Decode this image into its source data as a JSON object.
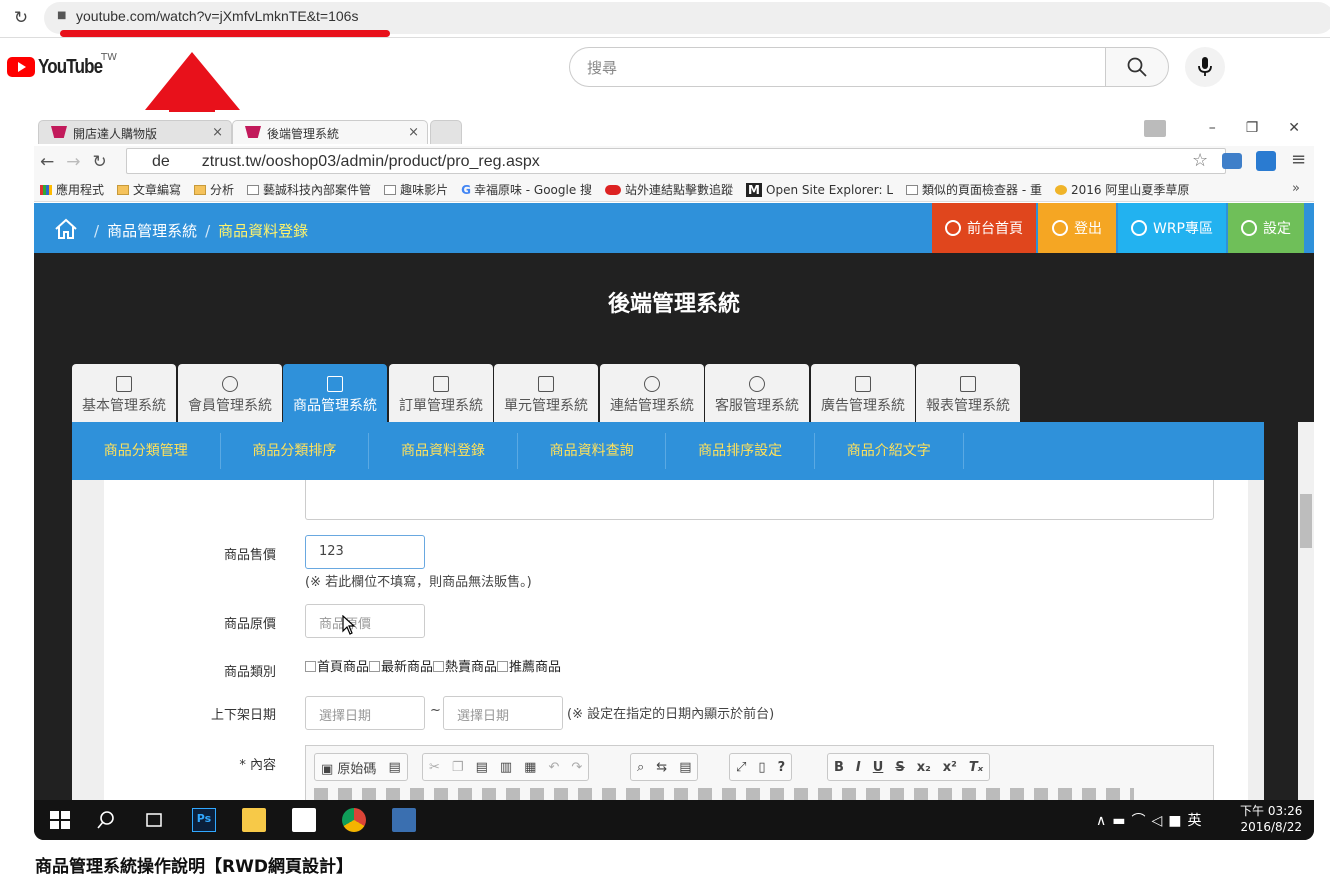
{
  "outer_browser": {
    "url": "youtube.com/watch?v=jXmfvLmknTE&t=106s"
  },
  "youtube": {
    "logo_text": "YouTube",
    "region": "TW",
    "search_placeholder": "搜尋",
    "video_title": "商品管理系統操作說明【RWD網頁設計】"
  },
  "inner_browser": {
    "tabs": [
      {
        "label": "開店達人購物版"
      },
      {
        "label": "後端管理系統"
      }
    ],
    "url_prefix": "de",
    "url_rest": "ztrust.tw/ooshop03/admin/product/pro_reg.aspx",
    "bookmarks": [
      "應用程式",
      "文章編寫",
      "分析",
      "藝誠科技內部案件管",
      "趣味影片",
      "幸福原味 - Google 搜",
      "站外連結點擊數追蹤",
      "Open Site Explorer: L",
      "類似的頁面檢查器 - 重",
      "2016 阿里山夏季草原"
    ]
  },
  "admin": {
    "breadcrumb": {
      "root": "商品管理系統",
      "current": "商品資料登錄"
    },
    "top_buttons": [
      {
        "label": "前台首頁",
        "color": "#e0461d"
      },
      {
        "label": "登出",
        "color": "#f5a623"
      },
      {
        "label": "WRP專區",
        "color": "#22b2f0"
      },
      {
        "label": "設定",
        "color": "#6fbf59"
      }
    ],
    "system_title": "後端管理系統",
    "module_tabs": [
      {
        "label": "基本管理系統",
        "active": false
      },
      {
        "label": "會員管理系統",
        "active": false
      },
      {
        "label": "商品管理系統",
        "active": true
      },
      {
        "label": "訂單管理系統",
        "active": false
      },
      {
        "label": "單元管理系統",
        "active": false
      },
      {
        "label": "連結管理系統",
        "active": false
      },
      {
        "label": "客服管理系統",
        "active": false
      },
      {
        "label": "廣告管理系統",
        "active": false
      },
      {
        "label": "報表管理系統",
        "active": false
      }
    ],
    "sub_nav": [
      "商品分類管理",
      "商品分類排序",
      "商品資料登錄",
      "商品資料查詢",
      "商品排序設定",
      "商品介紹文字"
    ],
    "form": {
      "price_label": "商品售價",
      "price_value": "123",
      "price_note": "(※ 若此欄位不填寫，則商品無法販售。)",
      "orig_price_label": "商品原價",
      "orig_price_placeholder": "商品原價",
      "category_label": "商品類別",
      "categories": [
        "首頁商品",
        "最新商品",
        "熱賣商品",
        "推薦商品"
      ],
      "date_label": "上下架日期",
      "date_start_placeholder": "選擇日期",
      "date_sep": "~",
      "date_end_placeholder": "選擇日期",
      "date_note": "(※ 設定在指定的日期內顯示於前台)",
      "content_label": "* 內容",
      "editor_source_btn": "原始碼"
    }
  },
  "taskbar": {
    "time": "下午 03:26",
    "date": "2016/8/22",
    "ime": "英"
  }
}
